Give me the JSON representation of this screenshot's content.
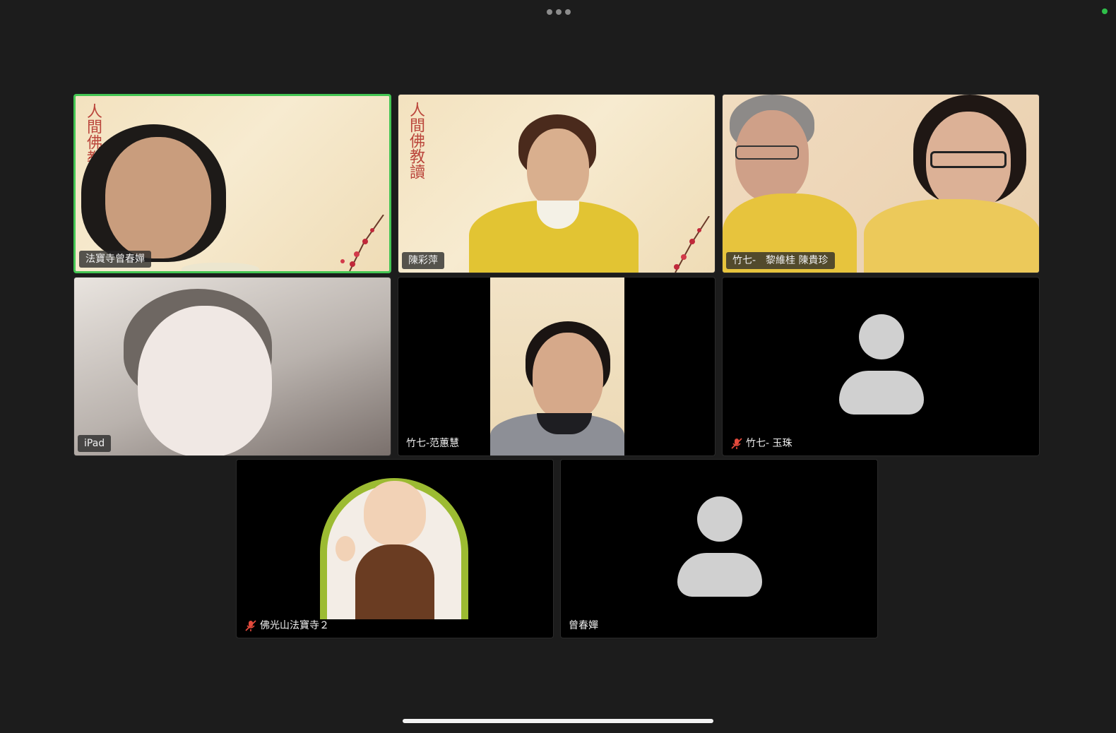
{
  "window": {
    "status": "connected"
  },
  "colors": {
    "active_speaker_border": "#44c553",
    "status_dot": "#2fbf4a",
    "mute_icon": "#e34a3c"
  },
  "participants": [
    {
      "name": "法寶寺曾春嬋",
      "video": "on",
      "muted": false,
      "active_speaker": true,
      "background_text": "人間佛教"
    },
    {
      "name": "陳彩萍",
      "video": "on",
      "muted": false,
      "active_speaker": false,
      "background_text": "人間佛教讀"
    },
    {
      "name": "竹七-　黎維桂 陳貴珍",
      "video": "on",
      "muted": false,
      "active_speaker": false
    },
    {
      "name": "iPad",
      "video": "on",
      "muted": false,
      "active_speaker": false
    },
    {
      "name": "竹七-范蕙慧",
      "video": "on",
      "muted": false,
      "active_speaker": false
    },
    {
      "name": "竹七- 玉珠",
      "video": "off",
      "muted": true,
      "active_speaker": false,
      "icon": "mic-off-icon"
    },
    {
      "name": "佛光山法寶寺２",
      "video": "on",
      "muted": true,
      "active_speaker": false,
      "icon": "mic-off-icon"
    },
    {
      "name": "曾春嬋",
      "video": "off",
      "muted": false,
      "active_speaker": false
    }
  ]
}
